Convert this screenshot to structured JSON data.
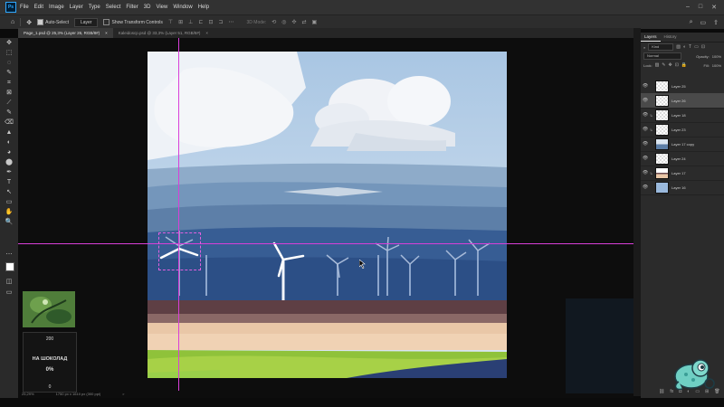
{
  "menubar": {
    "logo": "Ps",
    "items": [
      "File",
      "Edit",
      "Image",
      "Layer",
      "Type",
      "Select",
      "Filter",
      "3D",
      "View",
      "Window",
      "Help"
    ],
    "window_controls": [
      "–",
      "□",
      "✕"
    ]
  },
  "options": {
    "auto_select_label": "Auto-Select",
    "auto_select_checked": true,
    "auto_select_target": "Layer",
    "transform_controls_label": "Show Transform Controls",
    "transform_controls_checked": false,
    "mode_3d_label": "3D Mode:",
    "right_icons": [
      "search-icon",
      "workspace-icon",
      "share-icon"
    ]
  },
  "tabs": [
    {
      "label": "Page_1.psd @ 25,3% (Layer 26, RGB/8#)",
      "close": "×",
      "active": true
    },
    {
      "label": "Kaleidoscp.psd @ 33,3% (Layer 51, RGB/8#)",
      "close": "×",
      "active": false
    }
  ],
  "tools": [
    "✥",
    "⬚",
    "◌",
    "✎",
    "⌗",
    "⊠",
    "⟋",
    "✎",
    "⌫",
    "▲",
    "◐",
    "◕",
    "⬤",
    "✒",
    "T",
    "↖",
    "▭",
    "✋",
    "🔍"
  ],
  "donation": {
    "top": "200",
    "label": "НА ШОКОЛАД",
    "percent": "0%",
    "bottom": "0"
  },
  "status": {
    "zoom": "25,29%",
    "size": "1750 px x 1610 px (300 ppi)",
    "arrow": ">"
  },
  "layers_panel": {
    "tabs": [
      "Layers",
      "History"
    ],
    "kind_label": "Kind",
    "blend_mode": "Normal",
    "opacity_label": "Opacity:",
    "opacity_value": "100%",
    "lock_label": "Lock:",
    "fill_label": "Fill:",
    "fill_value": "100%",
    "layers": [
      {
        "name": "Layer 25",
        "selected": false,
        "clipped": false,
        "thumb": "checker"
      },
      {
        "name": "Layer 26",
        "selected": true,
        "clipped": false,
        "thumb": "checker"
      },
      {
        "name": "Layer 18",
        "selected": false,
        "clipped": true,
        "thumb": "checker"
      },
      {
        "name": "Layer 23",
        "selected": false,
        "clipped": true,
        "thumb": "checker"
      },
      {
        "name": "Layer 17 copy",
        "selected": false,
        "clipped": false,
        "thumb": "sky"
      },
      {
        "name": "Layer 24",
        "selected": false,
        "clipped": false,
        "thumb": "checker"
      },
      {
        "name": "Layer 17",
        "selected": false,
        "clipped": true,
        "thumb": "land"
      },
      {
        "name": "Layer 16",
        "selected": false,
        "clipped": false,
        "thumb": "blue"
      }
    ],
    "footer_icons": [
      "link-icon",
      "fx-icon",
      "mask-icon",
      "adjust-icon",
      "folder-icon",
      "new-layer-icon",
      "trash-icon"
    ]
  },
  "colors": {
    "accent": "#31a8ff",
    "guide": "#d93fd9",
    "sky": "#b9d2ea",
    "selected_row": "#4a4a4a"
  }
}
